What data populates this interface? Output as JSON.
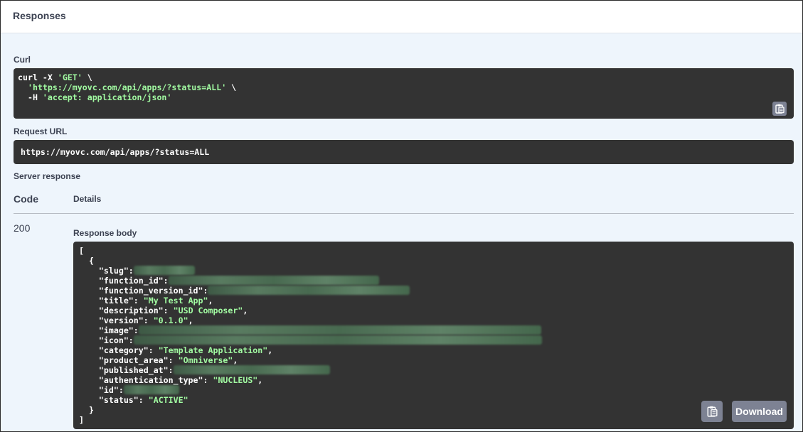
{
  "header": {
    "title": "Responses"
  },
  "curl": {
    "label": "Curl",
    "line1_cmd": "curl -X ",
    "line1_method": "'GET'",
    "line1_end": " \\",
    "line2_indent": "  ",
    "line2_url": "'https://myovc.com/api/apps/?status=ALL'",
    "line2_end": " \\",
    "line3_flag": "  -H ",
    "line3_header": "'accept: application/json'",
    "copy_icon": "clipboard-icon"
  },
  "request_url": {
    "label": "Request URL",
    "value": "https://myovc.com/api/apps/?status=ALL"
  },
  "server_response": {
    "label": "Server response",
    "col_code": "Code",
    "col_details": "Details",
    "code": "200",
    "body_label": "Response body",
    "download_label": "Download",
    "copy_icon": "clipboard-icon",
    "body": {
      "open_bracket": "[",
      "open_brace": "  {",
      "close_brace": "  }",
      "close_bracket": "]",
      "slug_key": "    \"slug\":",
      "function_id_key": "    \"function_id\":",
      "function_version_id_key": "    \"function_version_id\":",
      "title_key": "    \"title\": ",
      "title_val": "\"My Test App\"",
      "description_key": "    \"description\": ",
      "description_val": "\"USD Composer\"",
      "version_key": "    \"version\": ",
      "version_val": "\"0.1.0\"",
      "image_key": "    \"image\":",
      "icon_key": "    \"icon\":",
      "category_key": "    \"category\": ",
      "category_val": "\"Template Application\"",
      "product_area_key": "    \"product_area\": ",
      "product_area_val": "\"Omniverse\"",
      "published_at_key": "    \"published_at\":",
      "authentication_type_key": "    \"authentication_type\": ",
      "authentication_type_val": "\"NUCLEUS\"",
      "id_key": "    \"id\":",
      "status_key": "    \"status\": ",
      "status_val": "\"ACTIVE\"",
      "comma": ","
    }
  }
}
